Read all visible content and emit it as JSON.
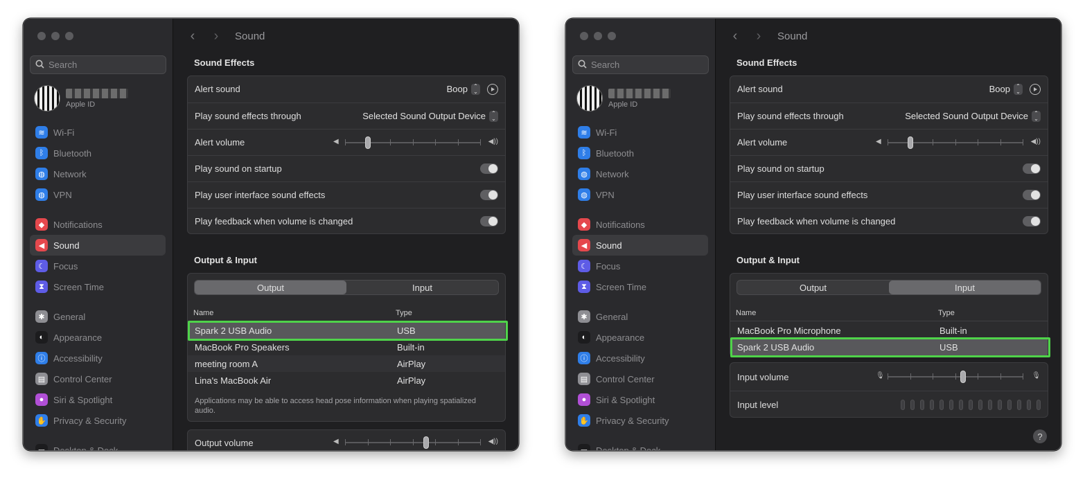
{
  "left": {
    "search": {
      "placeholder": "Search"
    },
    "account": {
      "subtitle": "Apple ID"
    },
    "sidebar": [
      {
        "label": "Wi-Fi",
        "color": "#2f7ee8",
        "icon": "wifi-icon"
      },
      {
        "label": "Bluetooth",
        "color": "#2f7ee8",
        "icon": "bluetooth-icon"
      },
      {
        "label": "Network",
        "color": "#2f7ee8",
        "icon": "globe-icon"
      },
      {
        "label": "VPN",
        "color": "#2f7ee8",
        "icon": "globe-icon"
      },
      {
        "label": "Notifications",
        "color": "#e5484d",
        "icon": "bell-icon"
      },
      {
        "label": "Sound",
        "color": "#e5484d",
        "icon": "speaker-icon"
      },
      {
        "label": "Focus",
        "color": "#5e5ce6",
        "icon": "moon-icon"
      },
      {
        "label": "Screen Time",
        "color": "#5e5ce6",
        "icon": "hourglass-icon"
      },
      {
        "label": "General",
        "color": "#8e8e93",
        "icon": "gear-icon"
      },
      {
        "label": "Appearance",
        "color": "#1c1c1e",
        "icon": "appearance-icon"
      },
      {
        "label": "Accessibility",
        "color": "#2f7ee8",
        "icon": "accessibility-icon"
      },
      {
        "label": "Control Center",
        "color": "#8e8e93",
        "icon": "control-center-icon"
      },
      {
        "label": "Siri & Spotlight",
        "color": "#b14fd6",
        "icon": "siri-icon"
      },
      {
        "label": "Privacy & Security",
        "color": "#2f7ee8",
        "icon": "hand-icon"
      },
      {
        "label": "Desktop & Dock",
        "color": "#1c1c1e",
        "icon": "dock-icon"
      }
    ],
    "breadcrumb_title": "Sound",
    "sound_effects": {
      "title": "Sound Effects",
      "alert_sound_label": "Alert sound",
      "alert_sound_value": "Boop",
      "play_through_label": "Play sound effects through",
      "play_through_value": "Selected Sound Output Device",
      "alert_volume_label": "Alert volume",
      "startup_label": "Play sound on startup",
      "ui_effects_label": "Play user interface sound effects",
      "feedback_label": "Play feedback when volume is changed"
    },
    "output_input": {
      "title": "Output & Input",
      "tab_output": "Output",
      "tab_input": "Input",
      "col_name": "Name",
      "col_type": "Type",
      "devices": [
        {
          "name": "Spark 2 USB Audio",
          "type": "USB"
        },
        {
          "name": "MacBook Pro Speakers",
          "type": "Built-in"
        },
        {
          "name": "meeting room A",
          "type": "AirPlay"
        },
        {
          "name": "Lina's MacBook Air",
          "type": "AirPlay"
        }
      ],
      "note": "Applications may be able to access head pose information when playing spatialized audio.",
      "output_volume_label": "Output volume"
    }
  },
  "right": {
    "search": {
      "placeholder": "Search"
    },
    "account": {
      "subtitle": "Apple ID"
    },
    "breadcrumb_title": "Sound",
    "sound_effects": {
      "title": "Sound Effects",
      "alert_sound_label": "Alert sound",
      "alert_sound_value": "Boop",
      "play_through_label": "Play sound effects through",
      "play_through_value": "Selected Sound Output Device",
      "alert_volume_label": "Alert volume",
      "startup_label": "Play sound on startup",
      "ui_effects_label": "Play user interface sound effects",
      "feedback_label": "Play feedback when volume is changed"
    },
    "output_input": {
      "title": "Output & Input",
      "tab_output": "Output",
      "tab_input": "Input",
      "col_name": "Name",
      "col_type": "Type",
      "devices": [
        {
          "name": "MacBook Pro Microphone",
          "type": "Built-in"
        },
        {
          "name": "Spark 2 USB Audio",
          "type": "USB"
        }
      ],
      "input_volume_label": "Input volume",
      "input_level_label": "Input level"
    },
    "help": "?"
  },
  "highlight_color": "#4fd34a"
}
